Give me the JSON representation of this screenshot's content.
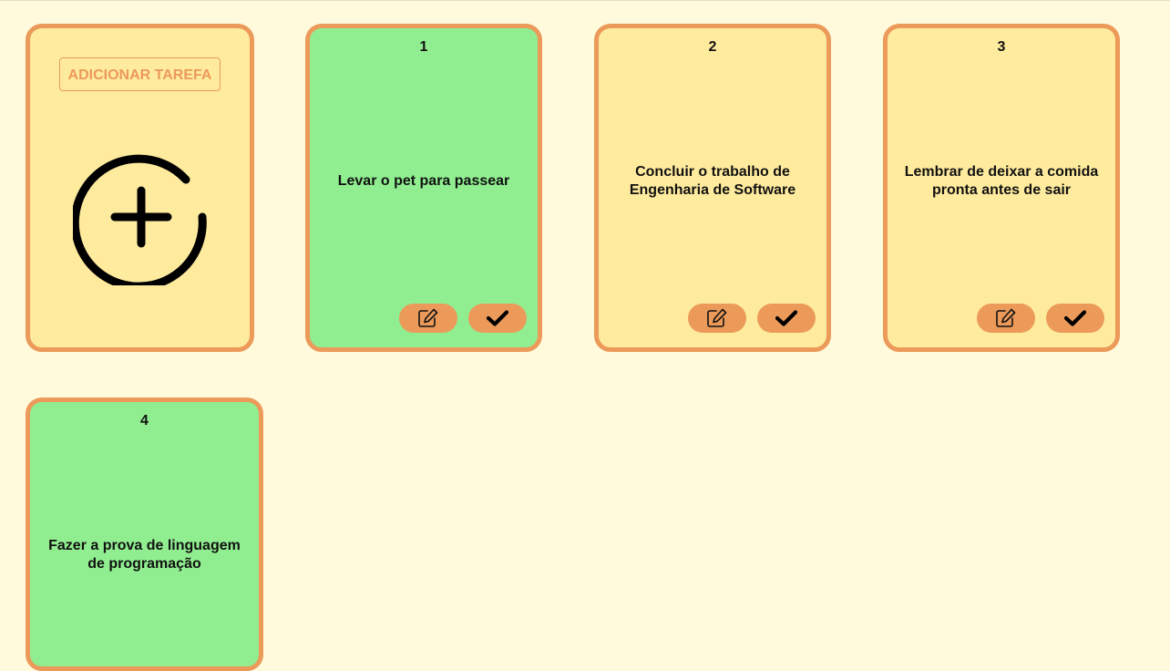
{
  "add_card": {
    "button_label": "ADICIONAR TAREFA",
    "icon": "plus-circle-icon"
  },
  "colors": {
    "background": "#fffadc",
    "card_pending": "#ffeb9e",
    "card_done": "#90ee90",
    "accent": "#ec9a5a"
  },
  "tasks": [
    {
      "number": "1",
      "text": "Levar o pet para passear",
      "status": "done"
    },
    {
      "number": "2",
      "text": "Concluir o trabalho de Engenharia de Software",
      "status": "pending"
    },
    {
      "number": "3",
      "text": "Lembrar de deixar a comida pronta antes de sair",
      "status": "pending"
    },
    {
      "number": "4",
      "text": "Fazer a prova de linguagem de programação",
      "status": "done"
    }
  ],
  "icons": {
    "edit": "edit-icon",
    "check": "check-icon"
  }
}
